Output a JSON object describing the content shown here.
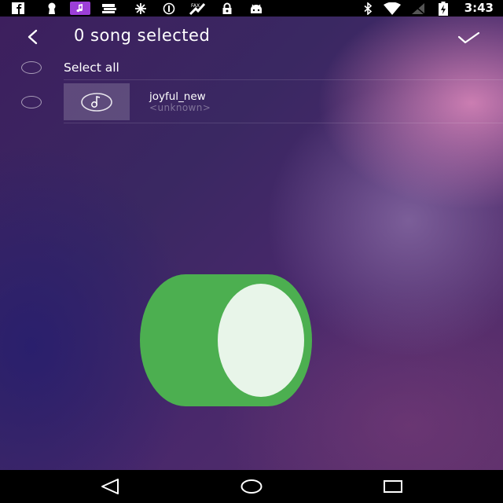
{
  "status_bar": {
    "time": "3:43",
    "icons": [
      "facebook-icon",
      "keyhole-icon",
      "music-app-icon",
      "tray-icon",
      "settings-burst-icon",
      "alert-circle-icon",
      "fax-icon",
      "lock-icon",
      "android-icon",
      "bluetooth-icon",
      "wifi-icon",
      "no-signal-icon",
      "battery-charging-icon"
    ]
  },
  "toolbar": {
    "title": "0 song selected",
    "back_icon": "chevron-left-icon",
    "confirm_icon": "checkmark-icon"
  },
  "select_all": {
    "label": "Select all"
  },
  "songs": [
    {
      "title": "joyful_new",
      "artist": "<unknown>",
      "icon": "music-note-icon"
    }
  ],
  "nav_bar": {
    "icons": [
      "back-triangle-icon",
      "home-circle-icon",
      "recents-square-icon"
    ]
  },
  "colors": {
    "music_accent": "#9c3fd8",
    "fab_green": "#4caf50",
    "fab_cap": "#e8f5e9"
  }
}
